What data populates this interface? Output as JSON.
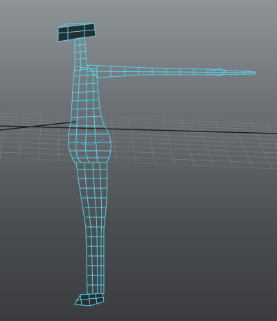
{
  "viewport": {
    "panel": "perspective-viewport",
    "background_top": "#8e9396",
    "background_bottom": "#3a3c3f",
    "grid_color": "#6f7377",
    "axis_color": "#1e1f21",
    "wire_color": "#55d8f2",
    "wire_dark": "#1a5c6e"
  }
}
